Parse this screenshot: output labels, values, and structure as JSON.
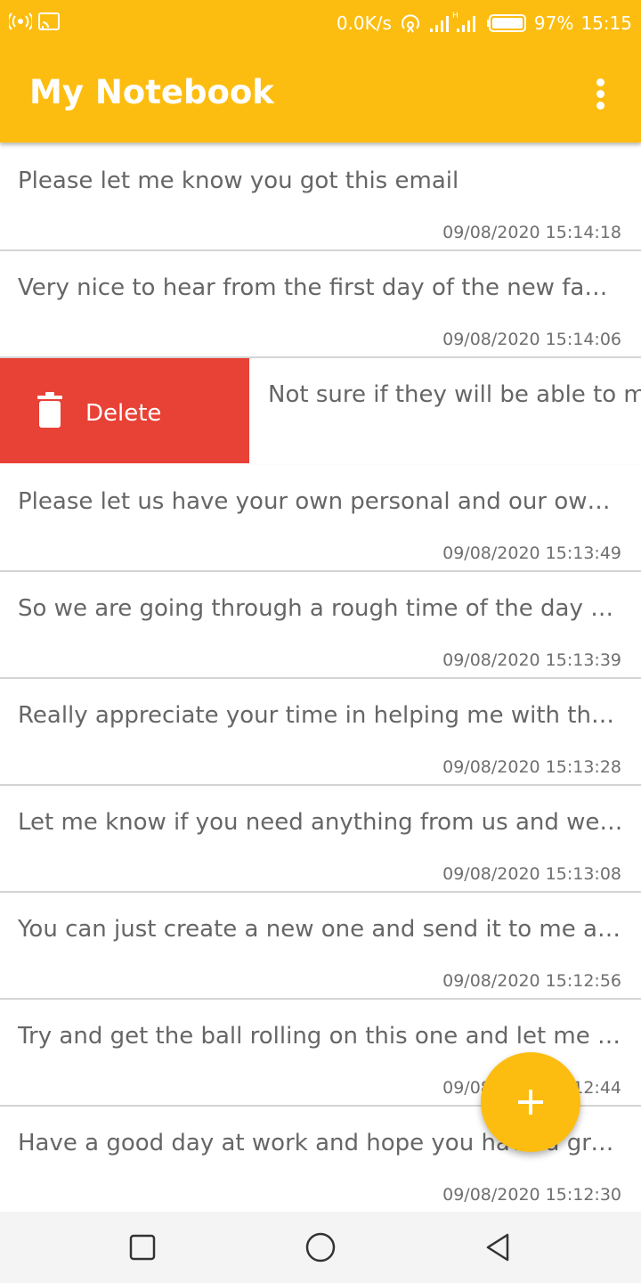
{
  "status_bar": {
    "network_speed": "0.0K/s",
    "battery_percent": "97%",
    "time": "15:15",
    "signal_type_label": "H",
    "icons": [
      "hotspot-icon",
      "cast-icon",
      "wifi-hotspot-icon",
      "signal-icon",
      "battery-icon"
    ]
  },
  "app_bar": {
    "title": "My Notebook",
    "menu_icon": "more-vert-icon"
  },
  "notes": [
    {
      "text": "Please let me know you got this email",
      "date": "09/08/2020 15:14:18"
    },
    {
      "text": "Very nice to hear from the first day of the new family …",
      "date": "09/08/2020 15:14:06"
    },
    {
      "text": "Not sure if they will be able to mak",
      "date": "",
      "swiped": true
    },
    {
      "text": "Please let us have your own personal and our own wa…",
      "date": "09/08/2020 15:13:49"
    },
    {
      "text": "So we are going through a rough time of the day with …",
      "date": "09/08/2020 15:13:39"
    },
    {
      "text": "Really appreciate your time in helping me with the ne…",
      "date": "09/08/2020 15:13:28"
    },
    {
      "text": "Let me know if you need anything from us and we wil…",
      "date": "09/08/2020 15:13:08"
    },
    {
      "text": "You can just create a new one and send it to me and I…",
      "date": "09/08/2020 15:12:56"
    },
    {
      "text": "Try and get the ball rolling on this one and let me kno…",
      "date": "09/08/2020 15:12:44"
    },
    {
      "text": "Have a good day at work and hope you have a great d…",
      "date": "09/08/2020 15:12:30"
    }
  ],
  "swipe_action": {
    "label": "Delete",
    "icon": "trash-icon",
    "color": "#E84136"
  },
  "fab": {
    "icon": "plus-icon"
  },
  "nav_bar": {
    "icons": [
      "recent-apps-icon",
      "home-icon",
      "back-icon"
    ]
  },
  "colors": {
    "primary": "#FDBD10",
    "delete": "#E84136",
    "text": "#666666"
  }
}
